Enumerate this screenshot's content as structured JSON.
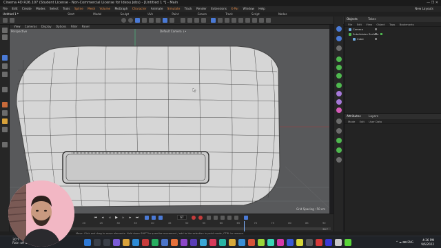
{
  "window": {
    "title": "Cinema 4D R26.107 (Student License - Non-Commercial License for Ideou Jobs) - [Untitled 1 *] - Main",
    "controls": "—  ❐  ✕"
  },
  "menubar": {
    "items": [
      "File",
      "Edit",
      "Create",
      "Modes",
      "Select",
      "Tools",
      "Spline",
      "Mesh",
      "Volume",
      "MoGraph",
      "Character",
      "Animate",
      "Simulate",
      "Track",
      "Render",
      "Extensions",
      "X-Par",
      "Window",
      "Help"
    ],
    "highlighted": [
      "Spline",
      "Mesh",
      "Volume",
      "Character",
      "Simulate",
      "X-Par"
    ],
    "new_layouts": "New Layouts"
  },
  "tabs": {
    "active": "Untitled 1 *",
    "layouts": [
      "Start",
      "Model",
      "Sculpt",
      "UVs",
      "Paint",
      "Groom",
      "Track",
      "Script",
      "Nodes"
    ]
  },
  "viewport": {
    "menu": [
      "View",
      "Cameras",
      "Display",
      "Options",
      "Filter",
      "Panel"
    ],
    "label": "Perspective",
    "camera": "Default Camera ↓•",
    "grid_spacing": "Grid Spacing : 50 cm"
  },
  "objects_panel": {
    "tabs": [
      "Objects",
      "Takes"
    ],
    "menu": [
      "File",
      "Edit",
      "View",
      "Object",
      "Tags",
      "Bookmarks"
    ],
    "rows": [
      {
        "name": "Camera",
        "icon_color": "#6fa8dc"
      },
      {
        "name": "Subdivision Surface",
        "icon_color": "#4fb84f"
      },
      {
        "name": "Cube",
        "icon_color": "#6fa8dc"
      }
    ]
  },
  "attributes_panel": {
    "tabs": [
      "Attributes",
      "Layers"
    ],
    "menu": [
      "Mode",
      "Edit",
      "User Data"
    ]
  },
  "timeline": {
    "current_frame": "67",
    "ticks": [
      "0",
      "5",
      "10",
      "15",
      "20",
      "25",
      "30",
      "35",
      "40",
      "45",
      "50",
      "55",
      "60",
      "65",
      "70",
      "75",
      "80",
      "85",
      "90"
    ],
    "end_frame": "90 F",
    "playhead_fraction": 0.745
  },
  "statusbar": {
    "hint": "Move: Click and drag to move elements. Hold down SHIFT to quantize movement / add to the selection in point mode, CTRL to remove."
  },
  "taskbar": {
    "weather_temp": "30°F",
    "weather_desc": "Rain off and on",
    "tray": "^  ☁  ⌨  ENG",
    "time": "4:26 PM",
    "date": "9/6/2022"
  },
  "colors": {
    "accent_orange": "#e08a4a",
    "selection_blue": "#4a7ad6",
    "viewport_bg": "#58595b"
  }
}
